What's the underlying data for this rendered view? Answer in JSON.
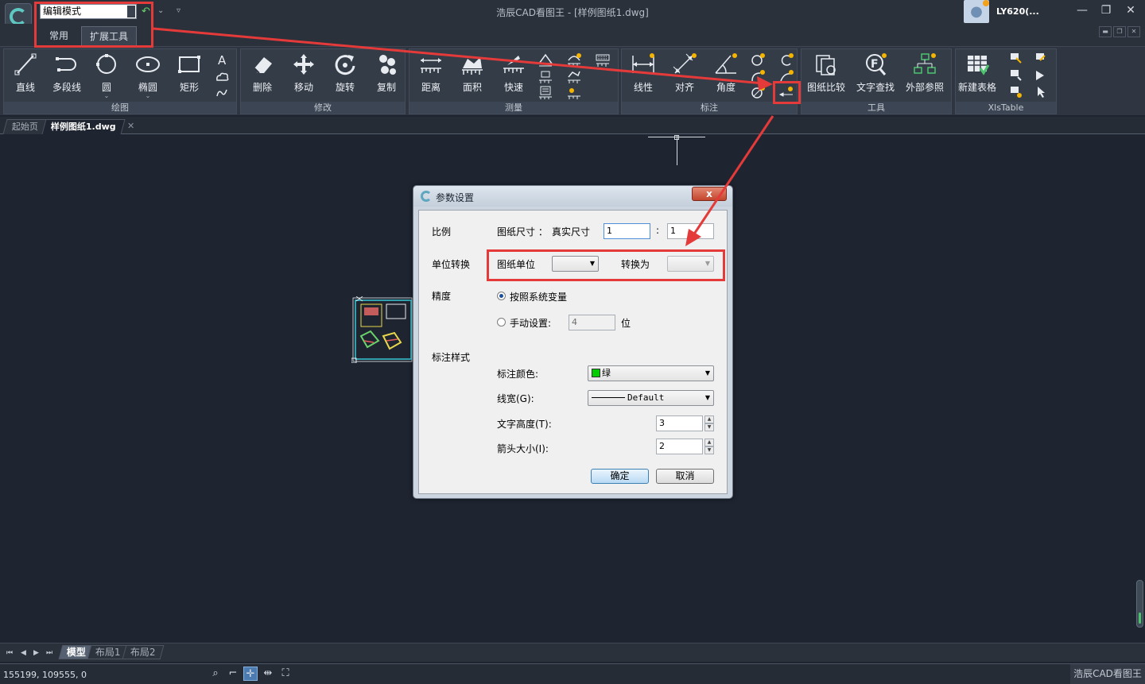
{
  "titlebar": {
    "mode_value": "编辑模式",
    "window_title": "浩辰CAD看图王 - [样例图纸1.dwg]",
    "user_name": "LY620(..."
  },
  "ribbon_tabs": [
    {
      "label": "常用",
      "active": false
    },
    {
      "label": "扩展工具",
      "active": true
    }
  ],
  "ribbon": {
    "groups": [
      {
        "label": "绘图",
        "tools": [
          "直线",
          "多段线",
          "圆",
          "椭圆",
          "矩形"
        ]
      },
      {
        "label": "修改",
        "tools": [
          "删除",
          "移动",
          "旋转",
          "复制"
        ]
      },
      {
        "label": "测量",
        "tools": [
          "距离",
          "面积",
          "快速"
        ]
      },
      {
        "label": "标注",
        "tools": [
          "线性",
          "对齐",
          "角度"
        ]
      },
      {
        "label": "工具",
        "tools": [
          "图纸比较",
          "文字查找",
          "外部参照"
        ]
      },
      {
        "label": "XlsTable",
        "tools": [
          "新建表格"
        ]
      }
    ]
  },
  "doc_tabs": [
    {
      "label": "起始页",
      "active": false
    },
    {
      "label": "样例图纸1.dwg",
      "active": true
    }
  ],
  "layout_tabs": [
    {
      "label": "模型",
      "active": true
    },
    {
      "label": "布局1",
      "active": false
    },
    {
      "label": "布局2",
      "active": false
    }
  ],
  "status": {
    "coords": "155199, 109555, 0",
    "brand": "浩辰CAD看图王"
  },
  "dialog": {
    "title": "参数设置",
    "close_label": "x",
    "scale": {
      "section": "比例",
      "paper_size_label": "图纸尺寸 ：",
      "real_size_label": "真实尺寸",
      "paper_value": "1",
      "separator": ":",
      "real_value": "1"
    },
    "unit": {
      "section": "单位转换",
      "paper_unit_label": "图纸单位",
      "paper_unit_value": "",
      "convert_label": "转换为",
      "convert_value": ""
    },
    "precision": {
      "section": "精度",
      "system_label": "按照系统变量",
      "manual_label": "手动设置:",
      "manual_value": "4",
      "digit_label": "位",
      "selected": "system"
    },
    "style": {
      "section": "标注样式",
      "color_label": "标注颜色:",
      "color_value": "绿",
      "color_swatch": "#00cc00",
      "linewidth_label": "线宽(G):",
      "linewidth_value": "Default",
      "text_height_label": "文字高度(T):",
      "text_height_value": "3",
      "arrow_size_label": "箭头大小(I):",
      "arrow_size_value": "2"
    },
    "ok_label": "确定",
    "cancel_label": "取消"
  },
  "colors": {
    "highlight": "#e53a3a",
    "canvas": "#1e2430",
    "accent": "#4cc46d"
  }
}
